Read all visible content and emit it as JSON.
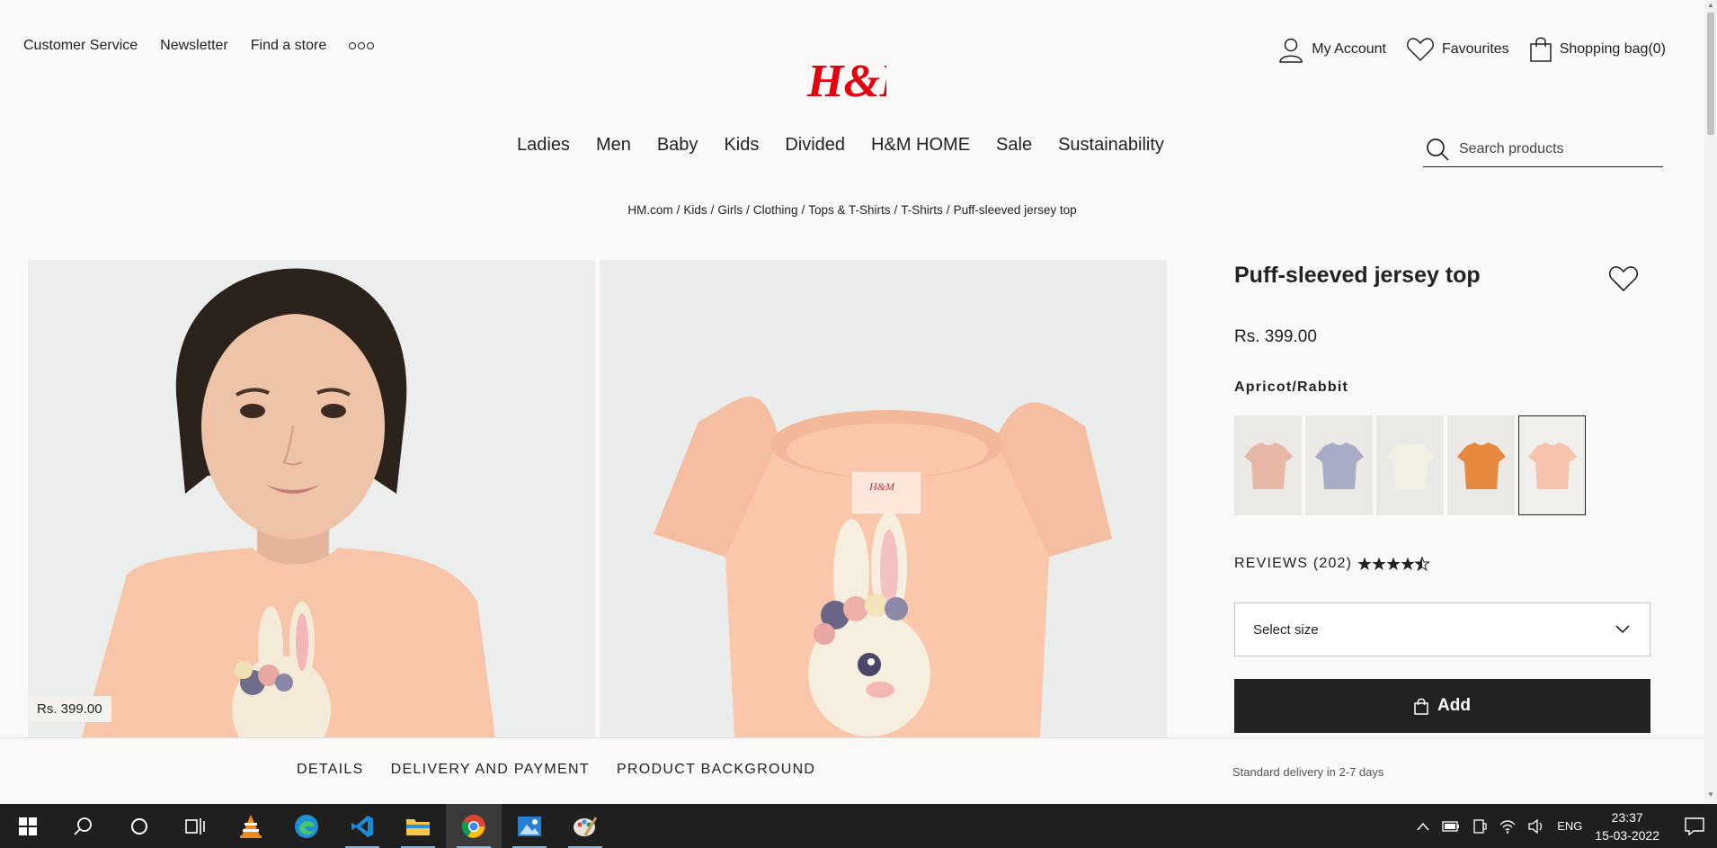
{
  "header": {
    "utility_left": [
      "Customer Service",
      "Newsletter",
      "Find a store"
    ],
    "logo_text": "H&M",
    "account": "My Account",
    "favourites": "Favourites",
    "bag": "Shopping bag(0)",
    "brand_color": "#e50010"
  },
  "nav": [
    "Ladies",
    "Men",
    "Baby",
    "Kids",
    "Divided",
    "H&M HOME",
    "Sale",
    "Sustainability"
  ],
  "search": {
    "placeholder": "Search products"
  },
  "breadcrumb": [
    "HM.com",
    "Kids",
    "Girls",
    "Clothing",
    "Tops & T-Shirts",
    "T-Shirts",
    "Puff-sleeved jersey top"
  ],
  "breadcrumb_sep": "/",
  "gallery": {
    "price_tag": "Rs. 399.00"
  },
  "product": {
    "title": "Puff-sleeved jersey top",
    "price": "Rs. 399.00",
    "color_name": "Apricot/Rabbit",
    "swatches": [
      {
        "color": "#e7b8a6",
        "selected": false
      },
      {
        "color": "#a9acc6",
        "selected": false
      },
      {
        "color": "#f2efe4",
        "selected": false
      },
      {
        "color": "#e7883f",
        "selected": false
      },
      {
        "color": "#f6c4ad",
        "selected": true
      }
    ],
    "reviews_label": "REVIEWS (202)",
    "rating": 4.5,
    "size_placeholder": "Select size",
    "add_label": "Add"
  },
  "tabs": [
    "DETAILS",
    "DELIVERY AND PAYMENT",
    "PRODUCT BACKGROUND"
  ],
  "delivery_note": "Standard delivery in 2-7 days",
  "taskbar": {
    "language": "ENG",
    "time": "23:37",
    "date": "15-03-2022"
  }
}
